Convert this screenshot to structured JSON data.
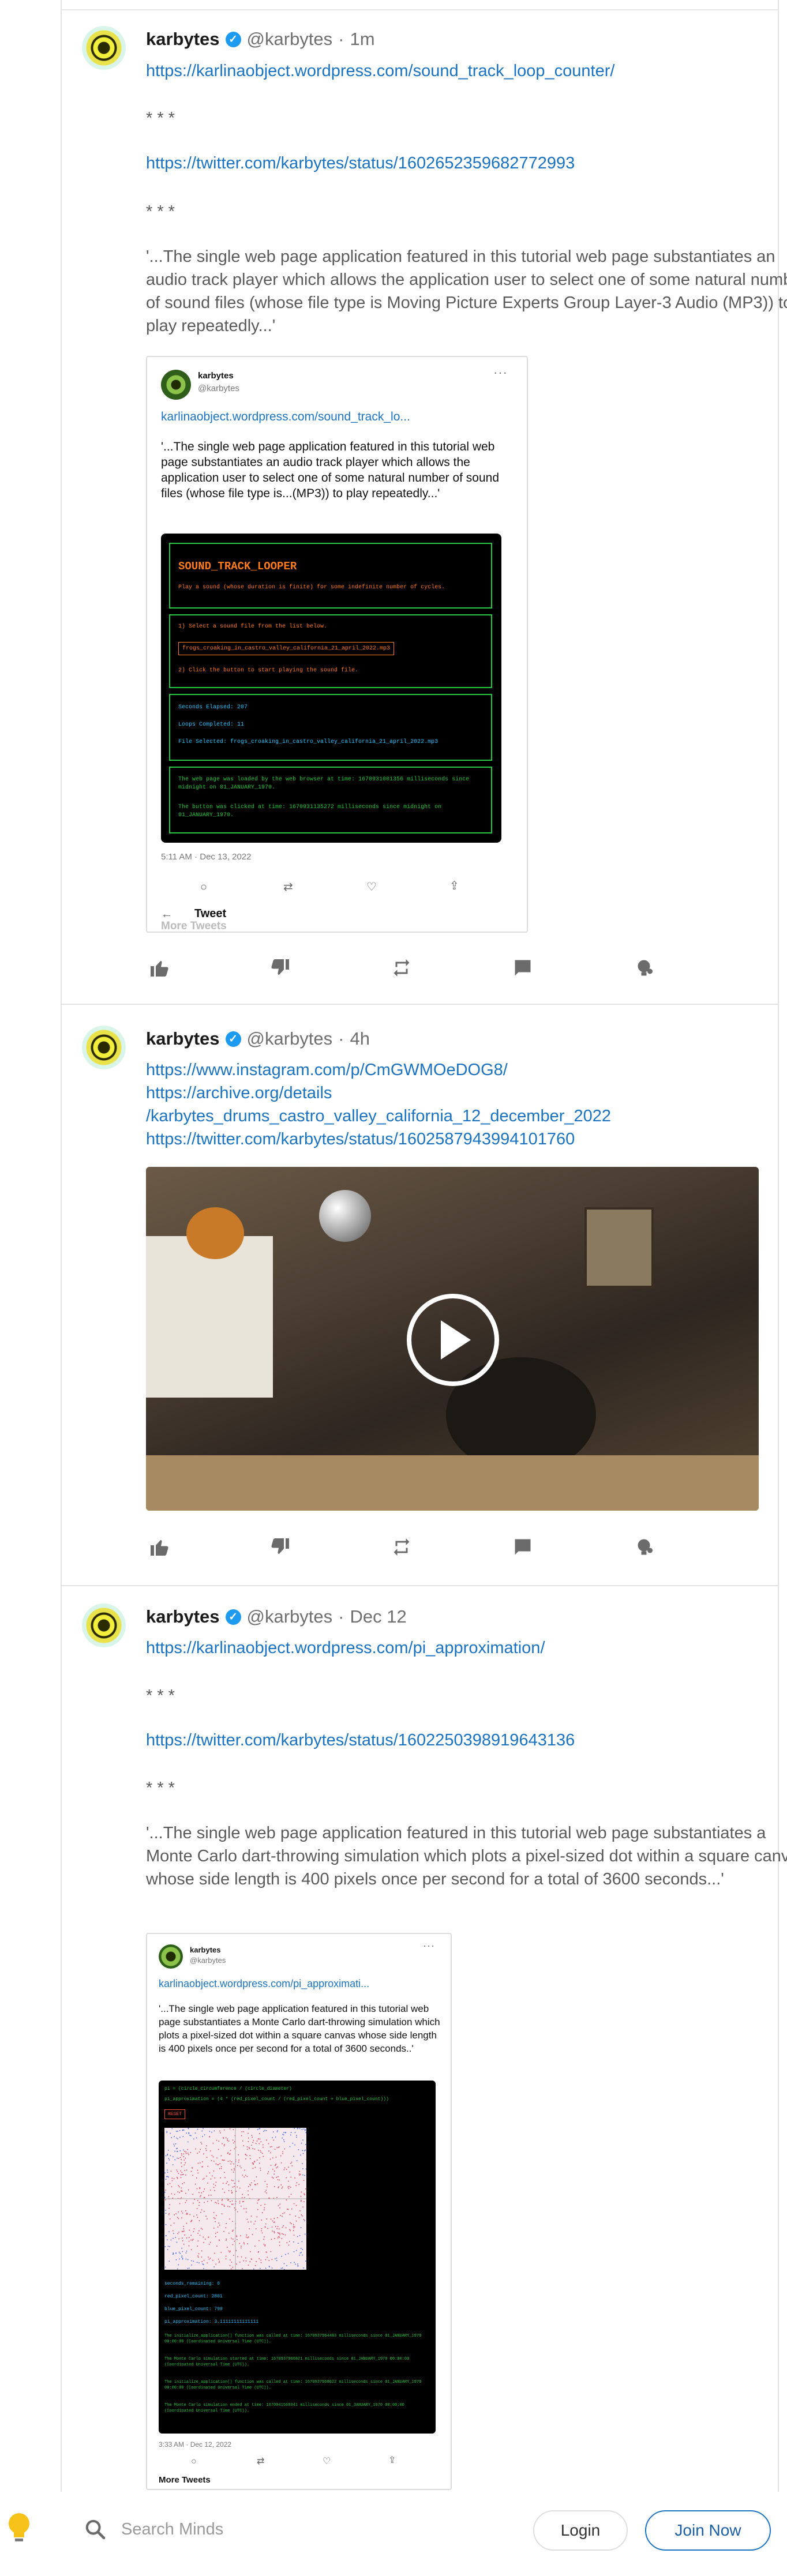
{
  "posts": [
    {
      "author": "karbytes",
      "handle": "@karbytes",
      "time": "1m",
      "links": [
        "https://karlinaobject.wordpress.com/sound_track_loop_counter/",
        "https://twitter.com/karbytes/status/1602652359682772993"
      ],
      "separator": "* * *",
      "quote": "'...The single web page application featured in this tutorial web page substantiates an audio track player which allows the application user to select one of some natural number of sound files (whose file type is Moving Picture Experts Group Layer-3 Audio (MP3)) to play repeatedly...'",
      "embed": {
        "name": "karbytes",
        "handle": "@karbytes",
        "link": "karlinaobject.wordpress.com/sound_track_lo...",
        "text": "'...The single web page application featured in this tutorial web page substantiates an audio track player which allows the application user to select one of some natural number of sound files (whose file type is...(MP3)) to play repeatedly...'",
        "app": {
          "title": "SOUND_TRACK_LOOPER",
          "subtitle": "Play a sound (whose duration is finite) for some indefinite number of cycles.",
          "step1": "1) Select a sound file from the list below.",
          "select_value": "frogs_croaking_in_castro_valley_california_21_april_2022.mp3",
          "step2": "2) Click the button to start playing the sound file.",
          "seconds": "Seconds Elapsed: 207",
          "loops": "Loops Completed: 11",
          "file": "File Selected: frogs_croaking_in_castro_valley_california_21_april_2022.mp3",
          "log1": "The web page was loaded by the web browser at time: 1670931001356 milliseconds since midnight on 01_JANUARY_1970.",
          "log2": "The button was clicked at time: 1670931135272 milliseconds since midnight on 01_JANUARY_1970."
        },
        "date": "5:11 AM · Dec 13, 2022",
        "tweet_label": "Tweet",
        "more": "More Tweets"
      }
    },
    {
      "author": "karbytes",
      "handle": "@karbytes",
      "time": "4h",
      "links": [
        "https://www.instagram.com/p/CmGWMOeDOG8/",
        "https://archive.org/details",
        "/karbytes_drums_castro_valley_california_12_december_2022",
        "https://twitter.com/karbytes/status/1602587943994101760"
      ]
    },
    {
      "author": "karbytes",
      "handle": "@karbytes",
      "time": "Dec 12",
      "links": [
        "https://karlinaobject.wordpress.com/pi_approximation/",
        "https://twitter.com/karbytes/status/1602250398919643136"
      ],
      "separator": "* * *",
      "quote": "'...The single web page application featured in this tutorial web page substantiates a Monte Carlo dart-throwing simulation which plots a pixel-sized dot within a square canvas whose side length is 400 pixels once per second for a total of 3600 seconds...'",
      "embed": {
        "name": "karbytes",
        "handle": "@karbytes",
        "link": "karlinaobject.wordpress.com/pi_approximati...",
        "text": "'...The single web page application featured in this tutorial web page substantiates a Monte Carlo dart-throwing simulation which plots a pixel-sized dot within a square canvas whose side length is 400 pixels once per second for a total of 3600 seconds..'",
        "app": {
          "line1": "pi = (circle_circumference / (circle_diameter)",
          "line2": "pi_approximation = (4 * (red_pixel_count / (red_pixel_count + blue_pixel_count)))",
          "reset": "RESET",
          "sec": "seconds_remaining: 0",
          "red": "red_pixel_count: 2801",
          "blue": "blue_pixel_count: 799",
          "pi": "pi_approximation: 3.11111111111111",
          "log1": "The initialize_application() function was called at time: 1670937964483 milliseconds since 01_JANUARY_1970 00:00:00 (Coordinated Universal Time (UTC)).",
          "log2": "The Monte Carlo simulation started at time: 1670937966821 milliseconds since 01_JANUARY_1970 00:00:00 (Coordinated Universal Time (UTC)).",
          "log3": "The initialize_application() function was called at time: 1670937968022 milliseconds since 01_JANUARY_1970 00:00:00 (Coordinated Universal Time (UTC)).",
          "log4": "The Monte Carlo simulation ended at time: 1670941569341 milliseconds since 01_JANUARY_1970 00:00:00 (Coordinated Universal Time (UTC))."
        },
        "date": "3:33 AM · Dec 12, 2022",
        "more": "More Tweets"
      }
    }
  ],
  "bottom": {
    "search_placeholder": "Search Minds",
    "login": "Login",
    "join": "Join Now"
  },
  "colors": {
    "link": "#1a73c2",
    "terminal_green": "#1fc93a",
    "terminal_orange": "#ff7a1a"
  },
  "icons": [
    "thumbs-up-icon",
    "thumbs-down-icon",
    "remind-icon",
    "comment-icon",
    "boost-icon",
    "search-icon",
    "bulb-icon",
    "play-icon"
  ]
}
